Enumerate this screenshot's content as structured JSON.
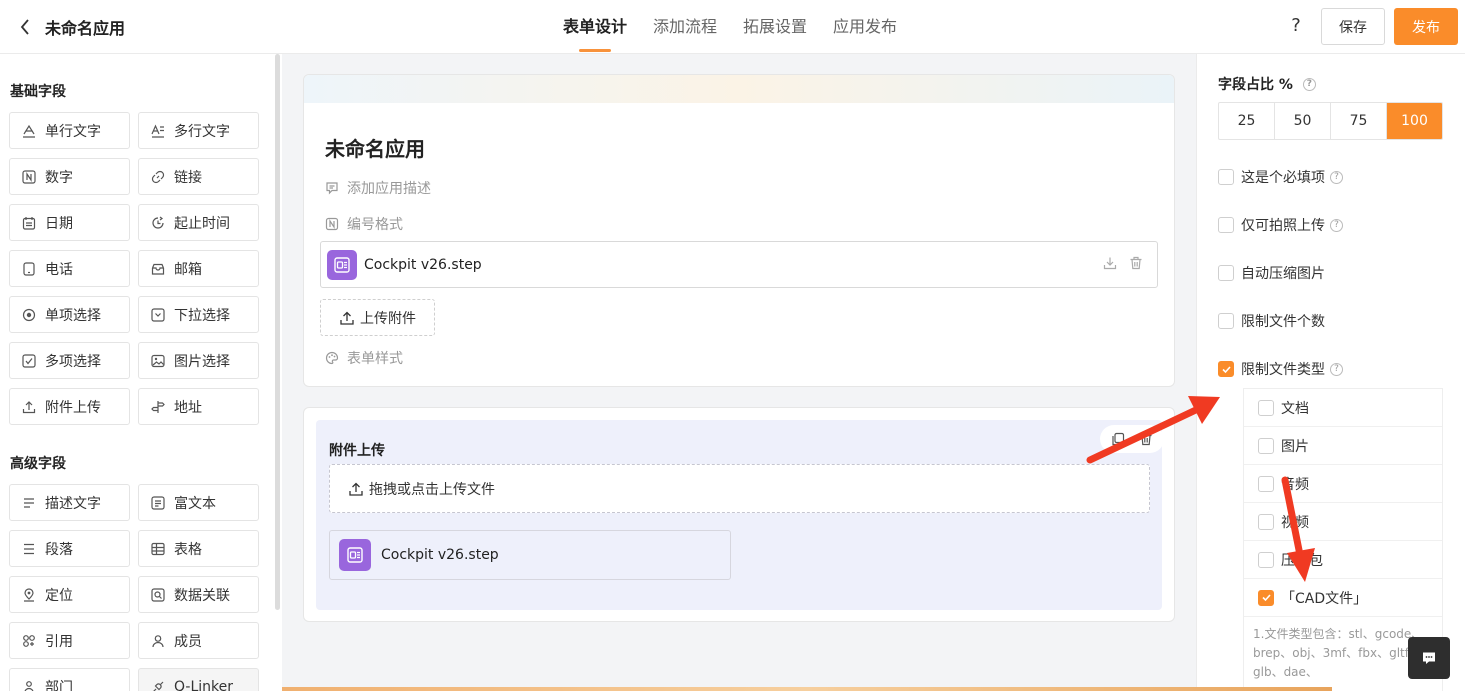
{
  "header": {
    "app_title": "未命名应用",
    "tabs": [
      {
        "label": "表单设计",
        "active": true
      },
      {
        "label": "添加流程",
        "active": false
      },
      {
        "label": "拓展设置",
        "active": false
      },
      {
        "label": "应用发布",
        "active": false
      }
    ],
    "help": "?",
    "save_label": "保存",
    "publish_label": "发布"
  },
  "left": {
    "basic_title": "基础字段",
    "basic": [
      {
        "label": "单行文字",
        "icon": "text-icon"
      },
      {
        "label": "多行文字",
        "icon": "multiline-text-icon"
      },
      {
        "label": "数字",
        "icon": "number-icon"
      },
      {
        "label": "链接",
        "icon": "link-icon"
      },
      {
        "label": "日期",
        "icon": "calendar-icon"
      },
      {
        "label": "起止时间",
        "icon": "time-range-icon"
      },
      {
        "label": "电话",
        "icon": "phone-icon"
      },
      {
        "label": "邮箱",
        "icon": "mail-icon"
      },
      {
        "label": "单项选择",
        "icon": "radio-icon"
      },
      {
        "label": "下拉选择",
        "icon": "dropdown-icon"
      },
      {
        "label": "多项选择",
        "icon": "checkbox-icon"
      },
      {
        "label": "图片选择",
        "icon": "image-icon"
      },
      {
        "label": "附件上传",
        "icon": "upload-icon"
      },
      {
        "label": "地址",
        "icon": "signpost-icon"
      }
    ],
    "advanced_title": "高级字段",
    "advanced": [
      {
        "label": "描述文字",
        "icon": "description-icon"
      },
      {
        "label": "富文本",
        "icon": "richtext-icon"
      },
      {
        "label": "段落",
        "icon": "paragraph-icon"
      },
      {
        "label": "表格",
        "icon": "table-icon"
      },
      {
        "label": "定位",
        "icon": "location-icon"
      },
      {
        "label": "数据关联",
        "icon": "data-link-icon"
      },
      {
        "label": "引用",
        "icon": "reference-icon"
      },
      {
        "label": "成员",
        "icon": "user-icon"
      },
      {
        "label": "部门",
        "icon": "department-icon"
      },
      {
        "label": "Q-Linker",
        "icon": "linker-icon"
      }
    ]
  },
  "form": {
    "title": "未命名应用",
    "add_desc": "添加应用描述",
    "number_format": "编号格式",
    "file_name": "Cockpit v26.step",
    "upload_label": "上传附件",
    "form_style": "表单样式"
  },
  "field": {
    "label": "附件上传",
    "drop_text": "拖拽或点击上传文件",
    "file_name": "Cockpit v26.step"
  },
  "props": {
    "ratio_title": "字段占比 %",
    "ratios": [
      "25",
      "50",
      "75",
      "100"
    ],
    "ratio_selected": "100",
    "checks": [
      {
        "label": "这是个必填项",
        "checked": false,
        "help": true
      },
      {
        "label": "仅可拍照上传",
        "checked": false,
        "help": true
      },
      {
        "label": "自动压缩图片",
        "checked": false,
        "help": false
      },
      {
        "label": "限制文件个数",
        "checked": false,
        "help": false
      },
      {
        "label": "限制文件类型",
        "checked": true,
        "help": true
      }
    ],
    "file_types": [
      {
        "label": "文档",
        "checked": false
      },
      {
        "label": "图片",
        "checked": false
      },
      {
        "label": "音频",
        "checked": false
      },
      {
        "label": "视频",
        "checked": false
      },
      {
        "label": "压缩包",
        "checked": false
      },
      {
        "label": "「CAD文件」",
        "checked": true
      }
    ],
    "note": "1.文件类型包含：stl、gcode、brep、obj、3mf、fbx、gltf、glb、dae、"
  },
  "colors": {
    "accent": "#fa8c2a",
    "annotation_arrow": "#f03a22",
    "file_icon": "#9966dd"
  }
}
